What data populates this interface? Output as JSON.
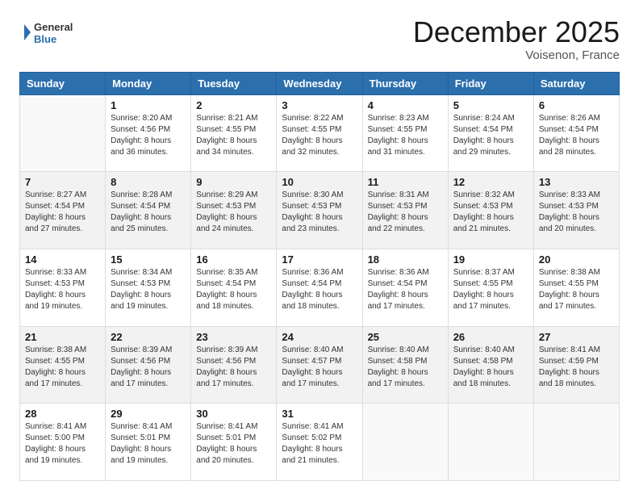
{
  "logo": {
    "line1": "General",
    "line2": "Blue"
  },
  "title": "December 2025",
  "location": "Voisenon, France",
  "weekdays": [
    "Sunday",
    "Monday",
    "Tuesday",
    "Wednesday",
    "Thursday",
    "Friday",
    "Saturday"
  ],
  "weeks": [
    [
      {
        "day": "",
        "info": ""
      },
      {
        "day": "1",
        "info": "Sunrise: 8:20 AM\nSunset: 4:56 PM\nDaylight: 8 hours\nand 36 minutes."
      },
      {
        "day": "2",
        "info": "Sunrise: 8:21 AM\nSunset: 4:55 PM\nDaylight: 8 hours\nand 34 minutes."
      },
      {
        "day": "3",
        "info": "Sunrise: 8:22 AM\nSunset: 4:55 PM\nDaylight: 8 hours\nand 32 minutes."
      },
      {
        "day": "4",
        "info": "Sunrise: 8:23 AM\nSunset: 4:55 PM\nDaylight: 8 hours\nand 31 minutes."
      },
      {
        "day": "5",
        "info": "Sunrise: 8:24 AM\nSunset: 4:54 PM\nDaylight: 8 hours\nand 29 minutes."
      },
      {
        "day": "6",
        "info": "Sunrise: 8:26 AM\nSunset: 4:54 PM\nDaylight: 8 hours\nand 28 minutes."
      }
    ],
    [
      {
        "day": "7",
        "info": "Sunrise: 8:27 AM\nSunset: 4:54 PM\nDaylight: 8 hours\nand 27 minutes."
      },
      {
        "day": "8",
        "info": "Sunrise: 8:28 AM\nSunset: 4:54 PM\nDaylight: 8 hours\nand 25 minutes."
      },
      {
        "day": "9",
        "info": "Sunrise: 8:29 AM\nSunset: 4:53 PM\nDaylight: 8 hours\nand 24 minutes."
      },
      {
        "day": "10",
        "info": "Sunrise: 8:30 AM\nSunset: 4:53 PM\nDaylight: 8 hours\nand 23 minutes."
      },
      {
        "day": "11",
        "info": "Sunrise: 8:31 AM\nSunset: 4:53 PM\nDaylight: 8 hours\nand 22 minutes."
      },
      {
        "day": "12",
        "info": "Sunrise: 8:32 AM\nSunset: 4:53 PM\nDaylight: 8 hours\nand 21 minutes."
      },
      {
        "day": "13",
        "info": "Sunrise: 8:33 AM\nSunset: 4:53 PM\nDaylight: 8 hours\nand 20 minutes."
      }
    ],
    [
      {
        "day": "14",
        "info": "Sunrise: 8:33 AM\nSunset: 4:53 PM\nDaylight: 8 hours\nand 19 minutes."
      },
      {
        "day": "15",
        "info": "Sunrise: 8:34 AM\nSunset: 4:53 PM\nDaylight: 8 hours\nand 19 minutes."
      },
      {
        "day": "16",
        "info": "Sunrise: 8:35 AM\nSunset: 4:54 PM\nDaylight: 8 hours\nand 18 minutes."
      },
      {
        "day": "17",
        "info": "Sunrise: 8:36 AM\nSunset: 4:54 PM\nDaylight: 8 hours\nand 18 minutes."
      },
      {
        "day": "18",
        "info": "Sunrise: 8:36 AM\nSunset: 4:54 PM\nDaylight: 8 hours\nand 17 minutes."
      },
      {
        "day": "19",
        "info": "Sunrise: 8:37 AM\nSunset: 4:55 PM\nDaylight: 8 hours\nand 17 minutes."
      },
      {
        "day": "20",
        "info": "Sunrise: 8:38 AM\nSunset: 4:55 PM\nDaylight: 8 hours\nand 17 minutes."
      }
    ],
    [
      {
        "day": "21",
        "info": "Sunrise: 8:38 AM\nSunset: 4:55 PM\nDaylight: 8 hours\nand 17 minutes."
      },
      {
        "day": "22",
        "info": "Sunrise: 8:39 AM\nSunset: 4:56 PM\nDaylight: 8 hours\nand 17 minutes."
      },
      {
        "day": "23",
        "info": "Sunrise: 8:39 AM\nSunset: 4:56 PM\nDaylight: 8 hours\nand 17 minutes."
      },
      {
        "day": "24",
        "info": "Sunrise: 8:40 AM\nSunset: 4:57 PM\nDaylight: 8 hours\nand 17 minutes."
      },
      {
        "day": "25",
        "info": "Sunrise: 8:40 AM\nSunset: 4:58 PM\nDaylight: 8 hours\nand 17 minutes."
      },
      {
        "day": "26",
        "info": "Sunrise: 8:40 AM\nSunset: 4:58 PM\nDaylight: 8 hours\nand 18 minutes."
      },
      {
        "day": "27",
        "info": "Sunrise: 8:41 AM\nSunset: 4:59 PM\nDaylight: 8 hours\nand 18 minutes."
      }
    ],
    [
      {
        "day": "28",
        "info": "Sunrise: 8:41 AM\nSunset: 5:00 PM\nDaylight: 8 hours\nand 19 minutes."
      },
      {
        "day": "29",
        "info": "Sunrise: 8:41 AM\nSunset: 5:01 PM\nDaylight: 8 hours\nand 19 minutes."
      },
      {
        "day": "30",
        "info": "Sunrise: 8:41 AM\nSunset: 5:01 PM\nDaylight: 8 hours\nand 20 minutes."
      },
      {
        "day": "31",
        "info": "Sunrise: 8:41 AM\nSunset: 5:02 PM\nDaylight: 8 hours\nand 21 minutes."
      },
      {
        "day": "",
        "info": ""
      },
      {
        "day": "",
        "info": ""
      },
      {
        "day": "",
        "info": ""
      }
    ]
  ]
}
